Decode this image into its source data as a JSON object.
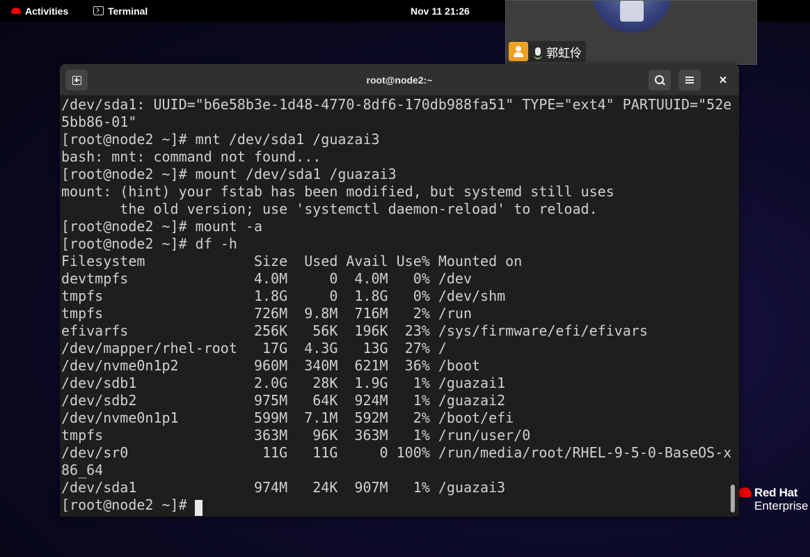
{
  "topbar": {
    "activities": "Activities",
    "app_name": "Terminal",
    "clock": "Nov 11  21:26"
  },
  "call_overlay": {
    "participant_name": "郭虹伶"
  },
  "branding": {
    "line1": "Red Hat",
    "line2": "Enterprise"
  },
  "window": {
    "title": "root@node2:~"
  },
  "terminal": {
    "lines": [
      "/dev/sda1: UUID=\"b6e58b3e-1d48-4770-8df6-170db988fa51\" TYPE=\"ext4\" PARTUUID=\"52e",
      "5bb86-01\"",
      "[root@node2 ~]# mnt /dev/sda1 /guazai3",
      "bash: mnt: command not found...",
      "[root@node2 ~]# mount /dev/sda1 /guazai3",
      "mount: (hint) your fstab has been modified, but systemd still uses",
      "       the old version; use 'systemctl daemon-reload' to reload.",
      "[root@node2 ~]# mount -a",
      "[root@node2 ~]# df -h",
      "Filesystem             Size  Used Avail Use% Mounted on",
      "devtmpfs               4.0M     0  4.0M   0% /dev",
      "tmpfs                  1.8G     0  1.8G   0% /dev/shm",
      "tmpfs                  726M  9.8M  716M   2% /run",
      "efivarfs               256K   56K  196K  23% /sys/firmware/efi/efivars",
      "/dev/mapper/rhel-root   17G  4.3G   13G  27% /",
      "/dev/nvme0n1p2         960M  340M  621M  36% /boot",
      "/dev/sdb1              2.0G   28K  1.9G   1% /guazai1",
      "/dev/sdb2              975M   64K  924M   1% /guazai2",
      "/dev/nvme0n1p1         599M  7.1M  592M   2% /boot/efi",
      "tmpfs                  363M   96K  363M   1% /run/user/0",
      "/dev/sr0                11G   11G     0 100% /run/media/root/RHEL-9-5-0-BaseOS-x",
      "86_64",
      "/dev/sda1              974M   24K  907M   1% /guazai3",
      "[root@node2 ~]# "
    ]
  }
}
